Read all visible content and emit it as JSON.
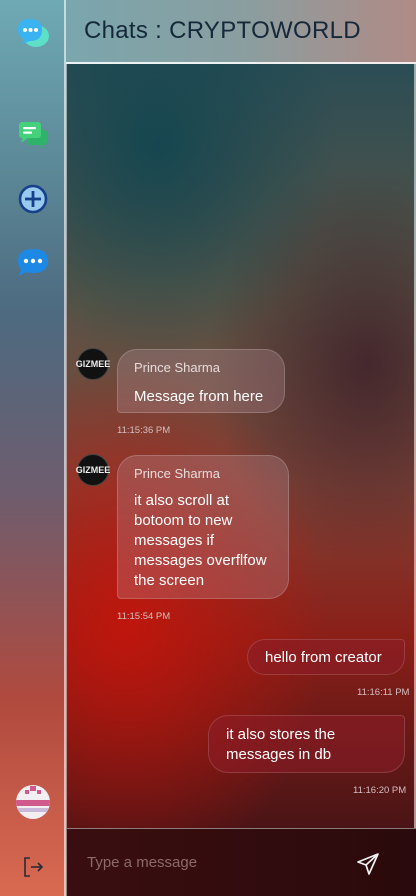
{
  "header": {
    "title": "Chats : CRYPTOWORLD"
  },
  "sidebar": {
    "icons": [
      "app-logo-chat-icon",
      "chats-icon",
      "new-chat-icon",
      "messages-icon",
      "profile-avatar",
      "logout-icon"
    ]
  },
  "messages": [
    {
      "direction": "in",
      "sender": "Prince Sharma",
      "lines": [
        "Message from here"
      ],
      "time": "11:15:36 PM",
      "avatar_text": "GIZMEE"
    },
    {
      "direction": "in",
      "sender": "Prince Sharma",
      "lines": [
        "it also scroll at",
        "botoom to new",
        "messages if",
        "messages overflfow",
        "the screen"
      ],
      "time": "11:15:54 PM",
      "avatar_text": "GIZMEE"
    },
    {
      "direction": "out",
      "lines": [
        "hello from creator"
      ],
      "time": "11:16:11 PM"
    },
    {
      "direction": "out",
      "lines": [
        "it also stores the",
        "messages in db"
      ],
      "time": "11:16:20 PM"
    }
  ],
  "composer": {
    "placeholder": "Type a message",
    "value": ""
  },
  "colors": {
    "accent": "#1e88e5",
    "sidebar_top": "#6fa9b4",
    "sidebar_bottom": "#d96a52"
  }
}
